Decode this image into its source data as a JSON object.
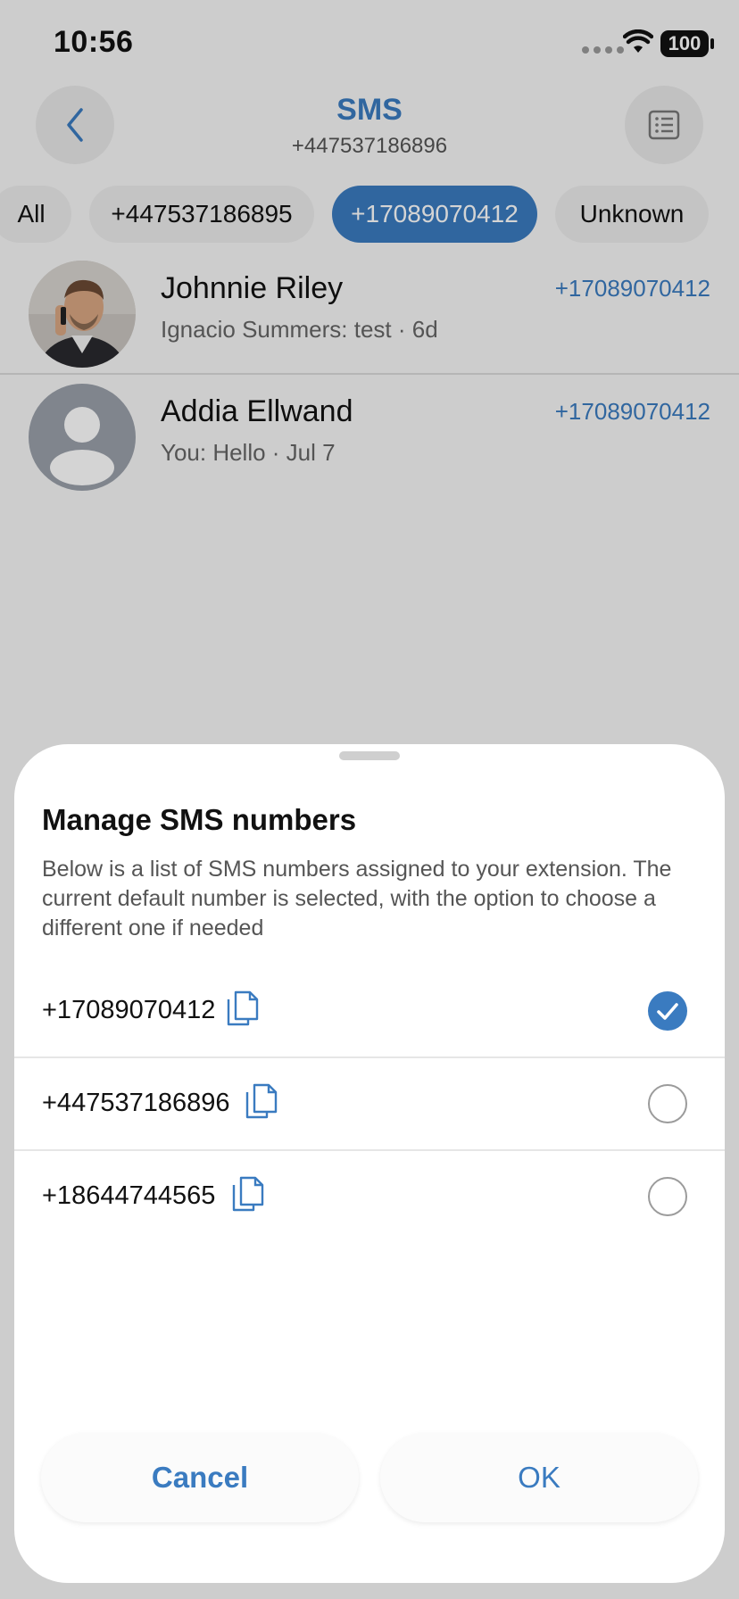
{
  "status_bar": {
    "time": "10:56",
    "battery": "100"
  },
  "nav": {
    "title": "SMS",
    "subtitle": "+447537186896"
  },
  "filters": [
    {
      "label": "All",
      "active": false
    },
    {
      "label": "+447537186895",
      "active": false
    },
    {
      "label": "+17089070412",
      "active": true
    },
    {
      "label": "Unknown",
      "active": false
    }
  ],
  "conversations": [
    {
      "name": "Johnnie Riley",
      "preview": "Ignacio Summers: test · 6d",
      "number": "+17089070412",
      "avatar": "photo"
    },
    {
      "name": "Addia Ellwand",
      "preview": "You: Hello · Jul 7",
      "number": "+17089070412",
      "avatar": "placeholder-person-icon"
    }
  ],
  "sheet": {
    "title": "Manage SMS numbers",
    "description": "Below is a list of SMS numbers assigned to your extension. The current default number is selected, with the option to choose a different one if needed",
    "options": [
      {
        "number": "+17089070412",
        "selected": true
      },
      {
        "number": "+447537186896",
        "selected": false
      },
      {
        "number": "+18644744565",
        "selected": false
      }
    ],
    "cancel_label": "Cancel",
    "ok_label": "OK"
  },
  "colors": {
    "accent": "#3a7bc0",
    "background": "#f7f7f7",
    "sheet": "#ffffff"
  },
  "icons": [
    "back-chevron-icon",
    "list-icon",
    "wifi-icon",
    "copy-icon",
    "checkmark-icon"
  ]
}
